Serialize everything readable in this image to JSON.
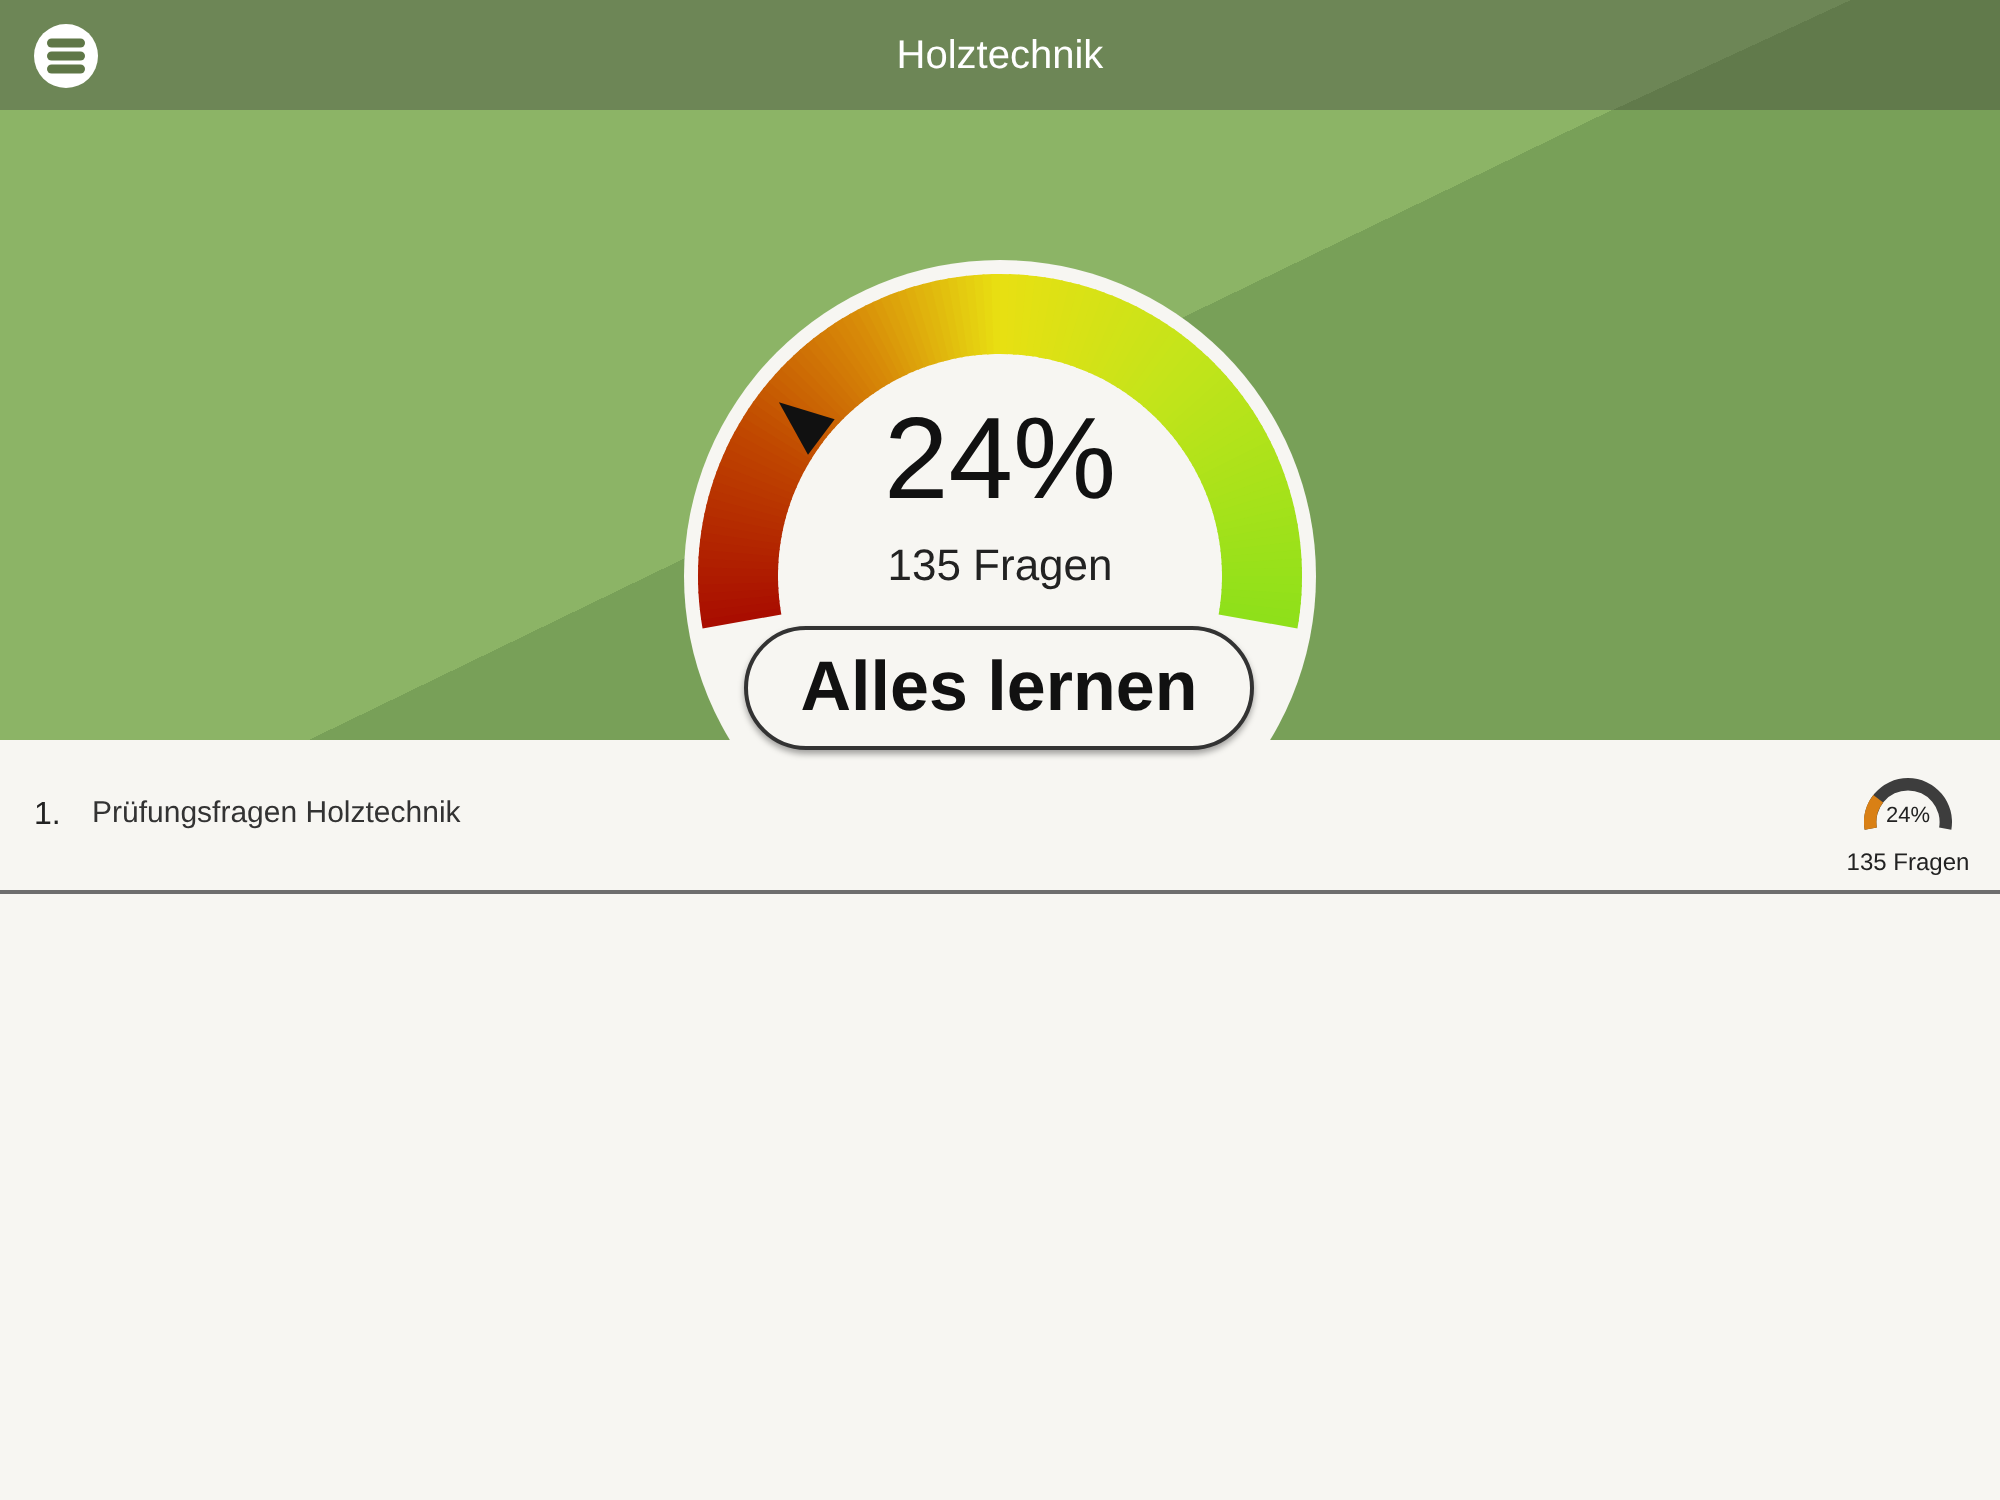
{
  "header": {
    "title": "Holztechnik"
  },
  "gauge": {
    "level": 0.24,
    "percent": "24%",
    "count": "135 Fragen"
  },
  "learn_button": {
    "label": "Alles lernen"
  },
  "list": [
    {
      "number": "1.",
      "title": "Prüfungsfragen Holztechnik",
      "level": 0.24,
      "percent": "24%",
      "count": "135 Fragen"
    }
  ]
}
